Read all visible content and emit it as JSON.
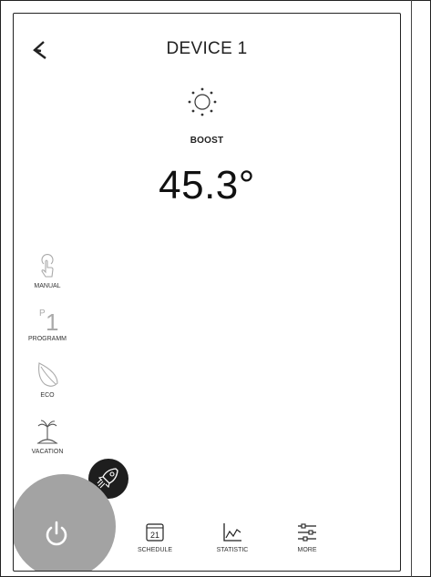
{
  "header": {
    "title": "DEVICE 1",
    "back_icon": "back-arrow-icon"
  },
  "status": {
    "mode_icon": "sun-icon",
    "mode_label": "BOOST",
    "temperature": "45.3°"
  },
  "sidebar": {
    "items": [
      {
        "label": "MANUAL",
        "icon": "hand-pointer-icon"
      },
      {
        "label": "PROGRAMM",
        "icon": "program-p1-icon",
        "badge_sup": "P",
        "badge_main": "1"
      },
      {
        "label": "ECO",
        "icon": "leaf-icon"
      },
      {
        "label": "VACATION",
        "icon": "palm-tree-icon"
      }
    ]
  },
  "boost_button": {
    "icon": "rocket-icon"
  },
  "power_button": {
    "icon": "power-icon",
    "color": "#a3a3a3"
  },
  "bottom_nav": {
    "items": [
      {
        "label": "SCHEDULE",
        "icon": "calendar-icon",
        "calendar_day": "21"
      },
      {
        "label": "STATISTIC",
        "icon": "chart-icon"
      },
      {
        "label": "MORE",
        "icon": "sliders-icon"
      }
    ]
  }
}
